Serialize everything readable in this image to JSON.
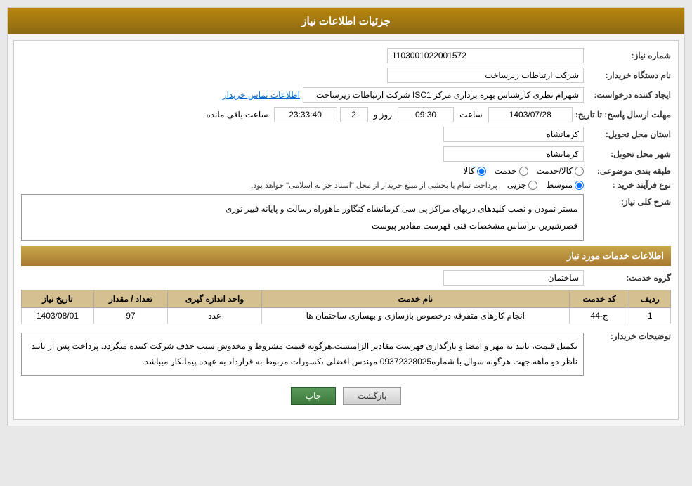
{
  "header": {
    "title": "جزئیات اطلاعات نیاز"
  },
  "fields": {
    "shomareNiaz_label": "شماره نیاز:",
    "shomareNiaz_value": "1103001022001572",
    "namDastgah_label": "نام دستگاه خریدار:",
    "namDastgah_value": "شرکت ارتباطات زیرساخت",
    "ijadKonande_label": "ایجاد کننده درخواست:",
    "ijadKonande_value": "شهرام نظری کارشناس بهره برداری مرکز ISC1 شرکت ارتباطات زیرساخت",
    "ijadKonande_link": "اطلاعات تماس خریدار",
    "mohlat_label": "مهلت ارسال پاسخ: تا تاریخ:",
    "mohlat_date": "1403/07/28",
    "mohlat_saat_label": "ساعت",
    "mohlat_saat_value": "09:30",
    "mohlat_roz_label": "روز و",
    "mohlat_roz_value": "2",
    "mohlat_remaining": "23:33:40",
    "mohlat_remaining_label": "ساعت باقی مانده",
    "ostan_label": "استان محل تحویل:",
    "ostan_value": "کرمانشاه",
    "shahr_label": "شهر محل تحویل:",
    "shahr_value": "کرمانشاه",
    "tabaqe_label": "طبقه بندی موضوعی:",
    "tabaqe_options": [
      "کالا",
      "خدمت",
      "کالا/خدمت"
    ],
    "tabaqe_selected": "کالا",
    "noeFarayand_label": "نوع فرآیند خرید :",
    "noeFarayand_options": [
      "جزیی",
      "متوسط"
    ],
    "noeFarayand_selected": "متوسط",
    "noeFarayand_note": "پرداخت تمام یا بخشی از مبلغ خریدار از محل \"اسناد خزانه اسلامی\" خواهد بود.",
    "sharhKoli_label": "شرح کلی نیاز:",
    "sharhKoli_text1": "مستر نمودن و نصب کلیدهای دربهای مراکز پی سی کرمانشاه کنگاور ماهوراه رسالت و پایانه فیبر نوری",
    "sharhKoli_text2": "قصرشیرین براساس مشخصات فنی فهرست مقادیر پیوست",
    "section2_label": "اطلاعات خدمات مورد نیاز",
    "groheKhadamat_label": "گروه خدمت:",
    "groheKhadamat_value": "ساختمان",
    "table": {
      "headers": [
        "ردیف",
        "کد خدمت",
        "نام خدمت",
        "واحد اندازه گیری",
        "تعداد / مقدار",
        "تاریخ نیاز"
      ],
      "rows": [
        {
          "radif": "1",
          "kodKhadamat": "ج-44",
          "namKhadamat": "انجام کارهای متفرقه درخصوص بازسازی و بهسازی ساختمان ها",
          "vahed": "عدد",
          "tedad": "97",
          "tarikh": "1403/08/01"
        }
      ]
    },
    "tawzihat_label": "توضیحات خریدار:",
    "tawzihat_text": "تکمیل قیمت، تایید به مهر و امضا و بارگذاری  فهرست مقادیر الزامیست.هرگونه قیمت مشروط و مخدوش سبب حذف شرکت کننده میگردد. پرداخت پس از تایید ناظر دو ماهه.جهت هرگونه سوال با شماره09372328025 مهندس افضلی ،کسورات مربوط به قرارداد به عهده پیمانکار میباشد.",
    "buttons": {
      "print": "چاپ",
      "back": "بازگشت"
    }
  }
}
